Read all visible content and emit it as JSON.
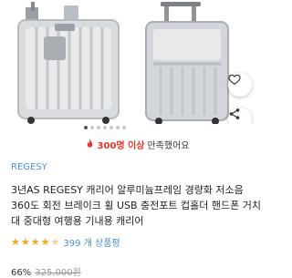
{
  "colors": {
    "accent": "#e8342a",
    "link": "#4a90d9",
    "star": "#f5a623"
  },
  "carousel": {
    "total": 7,
    "active": 0
  },
  "social_proof": {
    "icon": "fire-icon",
    "count": "300명 이상",
    "suffix": "만족했어요"
  },
  "product": {
    "brand": "REGESY",
    "title": "3년AS REGESY 캐리어 알루미늄프레임 경량화 저소음 360도 회전 브레이크 휠 USB 충전포트 컵홀더 핸드폰 거치대 중대형 여행용 기내용 캐리어",
    "rating": 4.5,
    "review_count": "399 개 상품평",
    "discount": "66%",
    "original_price": "325,000원"
  }
}
